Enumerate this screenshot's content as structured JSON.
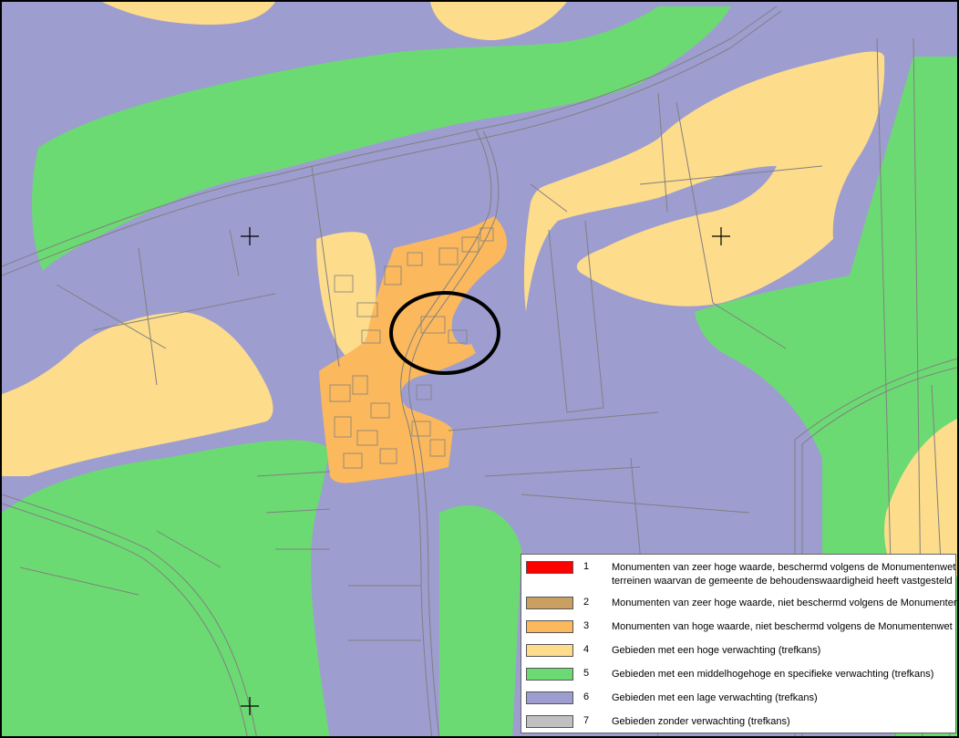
{
  "map": {
    "colors": {
      "purple": "#9d9dd0",
      "green": "#6cda72",
      "yellow": "#fddc8b",
      "orange": "#fbb85c",
      "line": "#808080"
    }
  },
  "legend": {
    "items": [
      {
        "num": "1",
        "color": "#ff0000",
        "text": "Monumenten van zeer hoge waarde, beschermd volgens de Monumentenwet en",
        "text2": "terreinen waarvan de gemeente de behoudenswaardigheid heeft vastgesteld"
      },
      {
        "num": "2",
        "color": "#c9a062",
        "text": "Monumenten van zeer hoge waarde, niet beschermd volgens de Monumentenwet"
      },
      {
        "num": "3",
        "color": "#fbb85c",
        "text": "Monumenten van hoge waarde, niet beschermd volgens de Monumentenwet"
      },
      {
        "num": "4",
        "color": "#fddc8b",
        "text": "Gebieden met een hoge verwachting (trefkans)"
      },
      {
        "num": "5",
        "color": "#6cda72",
        "text": "Gebieden met een middelhogehoge en specifieke verwachting (trefkans)"
      },
      {
        "num": "6",
        "color": "#9d9dd0",
        "text": "Gebieden met een lage verwachting (trefkans)"
      },
      {
        "num": "7",
        "color": "#c0c0c0",
        "text": "Gebieden zonder verwachting (trefkans)"
      }
    ]
  }
}
